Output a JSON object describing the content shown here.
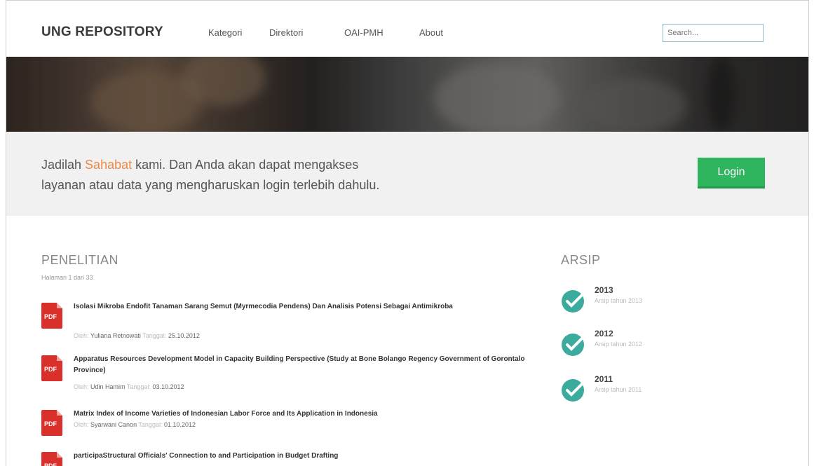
{
  "navbar": {
    "brand": "UNG REPOSITORY",
    "links": [
      "Kategori",
      "Direktori",
      "OAI-PMH",
      "About"
    ],
    "search_placeholder": "Search..."
  },
  "banner": {
    "text_before": "Jadilah ",
    "highlight": "Sahabat",
    "text_line1_after": " kami. Dan Anda akan dapat mengakses",
    "text_line2": "layanan atau data yang mengharuskan login terlebih dahulu.",
    "login_label": "Login",
    "highlight_color": "#e98a4a",
    "button_color": "#2fb55e"
  },
  "research": {
    "title": "PENELITIAN",
    "page_info": "Halaman 1 dari 33",
    "author_label": "Oleh:",
    "date_label": "Tanggal:",
    "items": [
      {
        "icon": "pdf-icon",
        "title": "Isolasi Mikroba Endofit Tanaman Sarang Semut (Myrmecodia Pendens) Dan Analisis Potensi Sebagai Antimikroba",
        "author": "Yuliana Retnowati",
        "date": "25.10.2012"
      },
      {
        "icon": "pdf-icon",
        "title": "Apparatus Resources Development Model in Capacity Building Perspective (Study at Bone Bolango Regency Government of Gorontalo Province)",
        "author": "Udin Hamim",
        "date": "03.10.2012"
      },
      {
        "icon": "pdf-icon",
        "title": "Matrix Index of Income Varieties of Indonesian Labor Force and Its Application in Indonesia",
        "author": "Syarwani Canon",
        "date": "01.10.2012"
      },
      {
        "icon": "pdf-icon",
        "title": "participaStructural Officials' Connection to and Participation in Budget Drafting",
        "author": "",
        "date": ""
      }
    ]
  },
  "archive": {
    "title": "ARSIP",
    "items": [
      {
        "year": "2013",
        "label": "Arsip tahun 2013"
      },
      {
        "year": "2012",
        "label": "Arsip tahun 2012"
      },
      {
        "year": "2011",
        "label": "Arsip tahun 2011"
      }
    ],
    "icon_color": "#3bab9e"
  }
}
